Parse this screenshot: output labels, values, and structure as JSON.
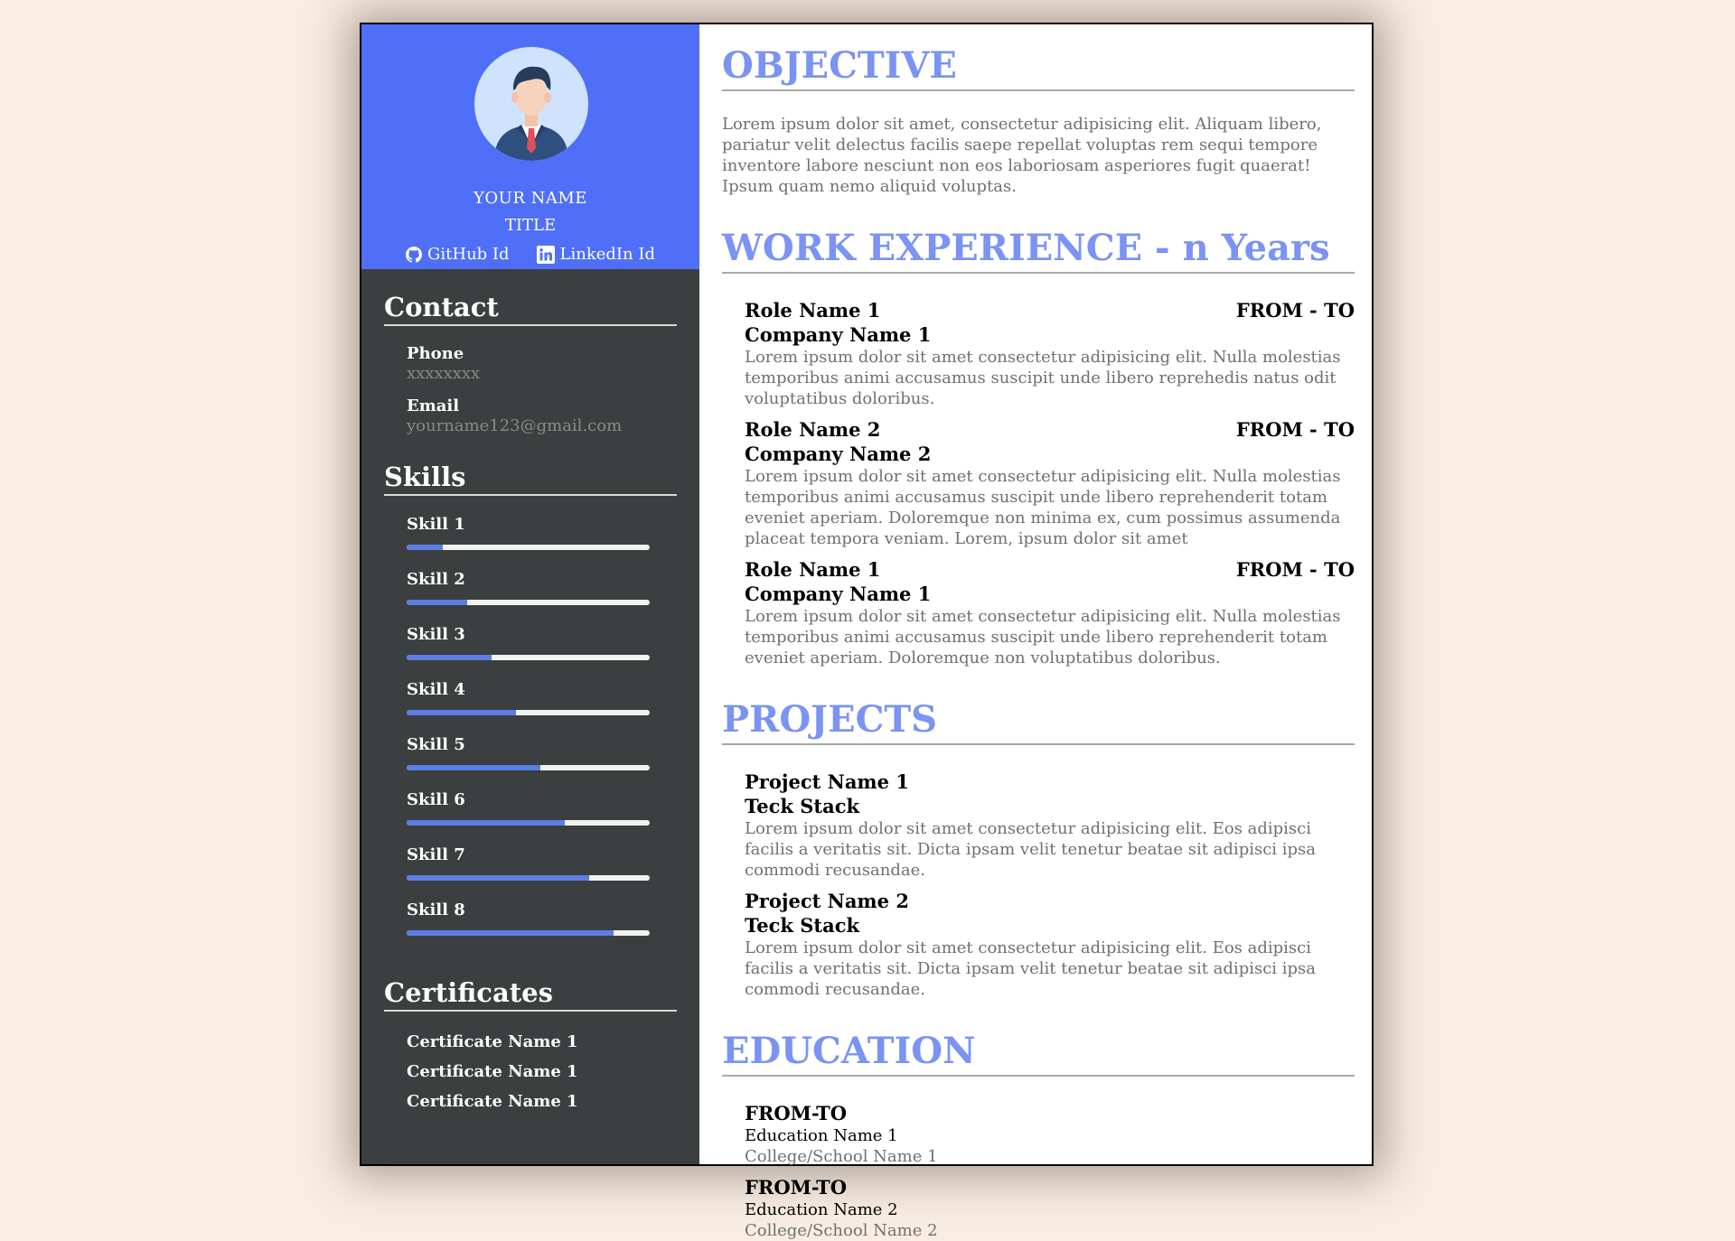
{
  "profile": {
    "name": "YOUR NAME",
    "title": "TITLE",
    "github_label": "GitHub Id",
    "linkedin_label": "LinkedIn Id"
  },
  "contact": {
    "heading": "Contact",
    "phone_label": "Phone",
    "phone_value": "xxxxxxxx",
    "email_label": "Email",
    "email_value": "yourname123@gmail.com"
  },
  "skills": {
    "heading": "Skills",
    "items": [
      {
        "name": "Skill 1",
        "level": 0.15
      },
      {
        "name": "Skill 2",
        "level": 0.25
      },
      {
        "name": "Skill 3",
        "level": 0.35
      },
      {
        "name": "Skill 4",
        "level": 0.45
      },
      {
        "name": "Skill 5",
        "level": 0.55
      },
      {
        "name": "Skill 6",
        "level": 0.65
      },
      {
        "name": "Skill 7",
        "level": 0.75
      },
      {
        "name": "Skill 8",
        "level": 0.85
      }
    ]
  },
  "certificates": {
    "heading": "Certificates",
    "items": [
      "Certificate Name 1",
      "Certificate Name 1",
      "Certificate Name 1"
    ]
  },
  "objective": {
    "heading": "OBJECTIVE",
    "text": "Lorem ipsum dolor sit amet, consectetur adipisicing elit. Aliquam libero, pariatur velit delectus facilis saepe repellat voluptas rem sequi tempore inventore labore nesciunt non eos laboriosam asperiores fugit quaerat! Ipsum quam nemo aliquid voluptas."
  },
  "work": {
    "heading": "WORK EXPERIENCE - n Years",
    "jobs": [
      {
        "role": "Role Name 1",
        "dates": "FROM - TO",
        "company": "Company Name 1",
        "description": "Lorem ipsum dolor sit amet consectetur adipisicing elit. Nulla molestias temporibus animi accusamus suscipit unde libero reprehedis natus odit voluptatibus doloribus."
      },
      {
        "role": "Role Name 2",
        "dates": "FROM - TO",
        "company": "Company Name 2",
        "description": "Lorem ipsum dolor sit amet consectetur adipisicing elit. Nulla molestias temporibus animi accusamus suscipit unde libero reprehenderit totam eveniet aperiam. Doloremque non minima ex, cum possimus assumenda placeat tempora veniam. Lorem, ipsum dolor sit amet"
      },
      {
        "role": "Role Name 1",
        "dates": "FROM - TO",
        "company": "Company Name 1",
        "description": "Lorem ipsum dolor sit amet consectetur adipisicing elit. Nulla molestias temporibus animi accusamus suscipit unde libero reprehenderit totam eveniet aperiam. Doloremque non voluptatibus doloribus."
      }
    ]
  },
  "projects": {
    "heading": "PROJECTS",
    "items": [
      {
        "name": "Project Name 1",
        "tech": "Teck Stack",
        "description": "Lorem ipsum dolor sit amet consectetur adipisicing elit. Eos adipisci facilis a veritatis sit. Dicta ipsam velit tenetur beatae sit adipisci ipsa commodi recusandae."
      },
      {
        "name": "Project Name 2",
        "tech": "Teck Stack",
        "description": "Lorem ipsum dolor sit amet consectetur adipisicing elit. Eos adipisci facilis a veritatis sit. Dicta ipsam velit tenetur beatae sit adipisci ipsa commodi recusandae."
      }
    ]
  },
  "education": {
    "heading": "EDUCATION",
    "items": [
      {
        "range": "FROM-TO",
        "name": "Education Name 1",
        "school": "College/School Name 1"
      },
      {
        "range": "FROM-TO",
        "name": "Education Name 2",
        "school": "College/School Name 2"
      }
    ]
  },
  "colors": {
    "page_background": "#f9ede3",
    "profile_background": "#4f6ff9",
    "sidebar_background": "#3b3f3f",
    "heading_accent": "#7b93f3",
    "skill_fill": "#5b7ee5"
  },
  "icons": {
    "avatar": "avatar-icon",
    "github": "github-icon",
    "linkedin": "linkedin-icon"
  }
}
